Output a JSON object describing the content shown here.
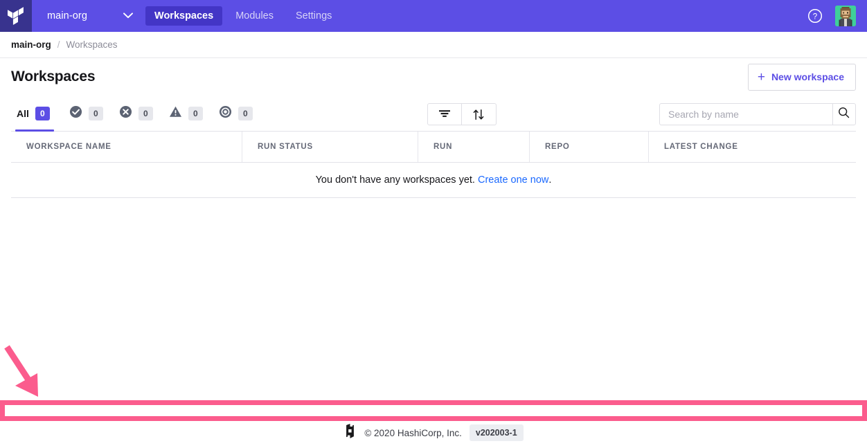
{
  "topnav": {
    "logo_icon": "terraform-logo-icon",
    "org_name": "main-org",
    "chevron_icon": "chevron-down-icon",
    "links": [
      {
        "label": "Workspaces",
        "active": true
      },
      {
        "label": "Modules",
        "active": false
      },
      {
        "label": "Settings",
        "active": false
      }
    ],
    "help_icon": "question-circle-icon",
    "avatar_icon": "user-avatar"
  },
  "breadcrumb": {
    "org": "main-org",
    "separator": "/",
    "current": "Workspaces"
  },
  "page": {
    "title": "Workspaces",
    "new_workspace_label": "New workspace",
    "plus_icon": "plus-icon"
  },
  "filters": {
    "tabs": [
      {
        "name": "all",
        "label": "All",
        "count": "0",
        "icon": "",
        "active": true
      },
      {
        "name": "applied",
        "label": "",
        "count": "0",
        "icon": "check-circle-icon",
        "active": false
      },
      {
        "name": "errored",
        "label": "",
        "count": "0",
        "icon": "x-circle-icon",
        "active": false
      },
      {
        "name": "needs-attention",
        "label": "",
        "count": "0",
        "icon": "warning-triangle-icon",
        "active": false
      },
      {
        "name": "running",
        "label": "",
        "count": "0",
        "icon": "target-circle-icon",
        "active": false
      }
    ],
    "filter_icon": "filter-funnel-icon",
    "sort_icon": "sort-arrows-icon",
    "search_placeholder": "Search by name",
    "search_value": "",
    "search_icon": "search-icon"
  },
  "table": {
    "columns": [
      "WORKSPACE NAME",
      "RUN STATUS",
      "RUN",
      "REPO",
      "LATEST CHANGE"
    ],
    "empty_text": "You don't have any workspaces yet.",
    "empty_link": "Create one now",
    "empty_period": "."
  },
  "footer": {
    "logo_icon": "hashicorp-logo-icon",
    "copyright": "© 2020 HashiCorp, Inc.",
    "version": "v202003-1"
  },
  "annotations": {
    "highlight_color": "#fb5c8d",
    "arrow_icon": "pointer-arrow-icon",
    "rect_icon": "highlight-rectangle"
  },
  "colors": {
    "brand_purple": "#5c4ee5",
    "logo_purple": "#38338e",
    "link_blue": "#1b69ff",
    "annotation_pink": "#fb5c8d"
  }
}
